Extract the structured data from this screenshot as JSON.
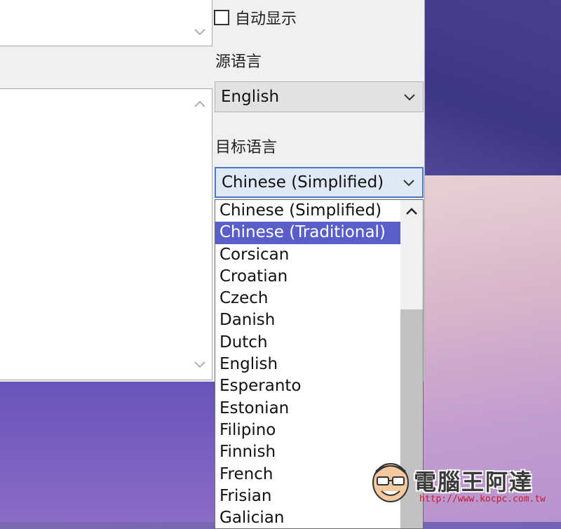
{
  "auto_display_label": "自动显示",
  "source_language": {
    "label": "源语言",
    "selected": "English"
  },
  "target_language": {
    "label": "目标语言",
    "selected": "Chinese (Simplified)"
  },
  "dropdown_options": [
    "Chinese (Simplified)",
    "Chinese (Traditional)",
    "Corsican",
    "Croatian",
    "Czech",
    "Danish",
    "Dutch",
    "English",
    "Esperanto",
    "Estonian",
    "Filipino",
    "Finnish",
    "French",
    "Frisian",
    "Galician"
  ],
  "highlighted_index": 1,
  "watermark": {
    "brand": "電腦王阿達",
    "url": "http://www.kocpc.com.tw"
  },
  "colors": {
    "highlight": "#5a5ec8",
    "focus_border": "#4a78c7"
  }
}
